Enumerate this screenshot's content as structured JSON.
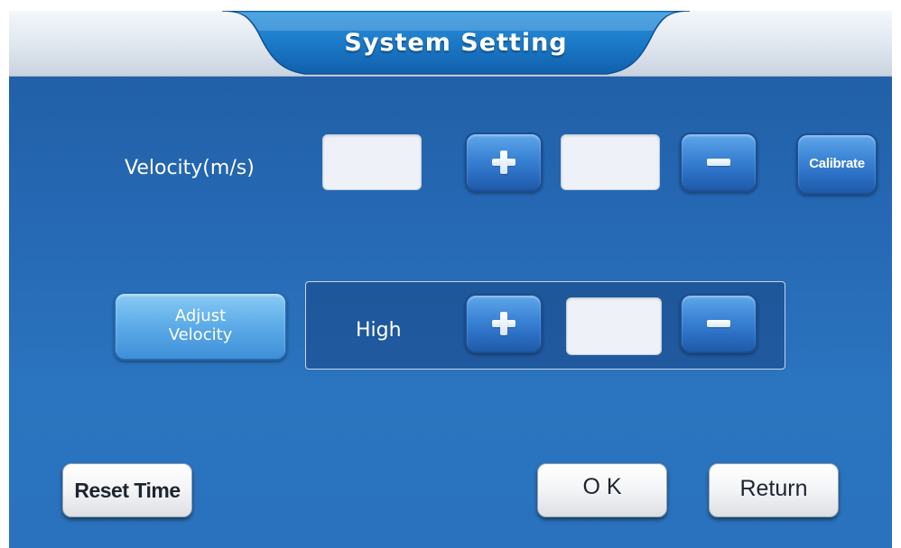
{
  "header": {
    "title": "System Setting"
  },
  "velocity_row": {
    "label": "Velocity(m/s)",
    "current_value": "",
    "adjust_value": "",
    "increment_icon": "plus-icon",
    "decrement_icon": "minus-icon",
    "calibrate_label": "Calibrate"
  },
  "adjust_row": {
    "adjust_button_line1": "Adjust",
    "adjust_button_line2": "Velocity",
    "level_label": "High",
    "level_value": "",
    "increment_icon": "plus-icon",
    "decrement_icon": "minus-icon"
  },
  "footer": {
    "reset_time_label": "Reset Time",
    "ok_label": "O K",
    "return_label": "Return"
  },
  "colors": {
    "background": "#2567b2",
    "header_accent": "#1e7fd0",
    "button_blue": "#3d86d6",
    "button_white": "#f3f4f6",
    "value_box": "#eef1f7"
  }
}
